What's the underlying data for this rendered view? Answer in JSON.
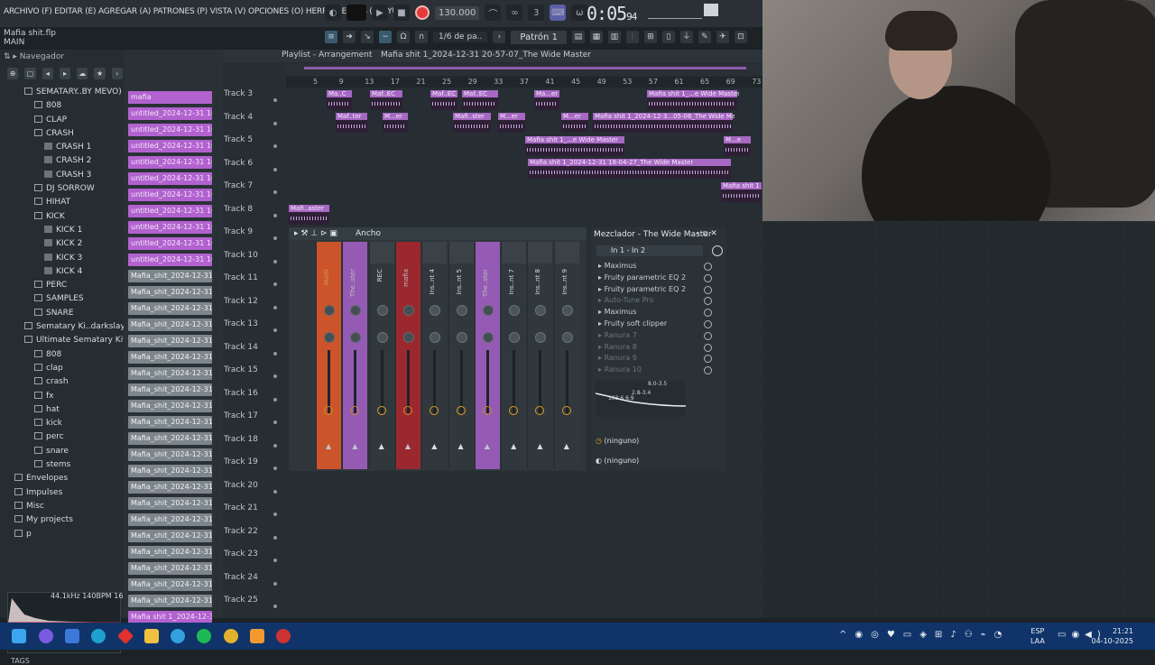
{
  "menu": {
    "text": "ARCHIVO (F) EDITAR (E) AGREGAR (A) PATRONES (P) VISTA (V) OPCIONES (O) HERRAMIENTAS (T) AYUDA"
  },
  "transport": {
    "tempo": "130.000",
    "time_main": "0:05",
    "time_sub": "94"
  },
  "project": {
    "name": "Mafia shit.flp",
    "sub": "MAIN"
  },
  "toolbar2": {
    "snap": "1/6 de pa..",
    "pattern": "Patrón 1"
  },
  "browser": {
    "header": "Navegador",
    "items": [
      {
        "label": "SEMATARY..BY MEVO)",
        "indent": 1,
        "type": "folder"
      },
      {
        "label": "808",
        "indent": 2,
        "type": "folder"
      },
      {
        "label": "CLAP",
        "indent": 2,
        "type": "folder"
      },
      {
        "label": "CRASH",
        "indent": 2,
        "type": "folder"
      },
      {
        "label": "CRASH 1",
        "indent": 3,
        "type": "file"
      },
      {
        "label": "CRASH 2",
        "indent": 3,
        "type": "file"
      },
      {
        "label": "CRASH 3",
        "indent": 3,
        "type": "file"
      },
      {
        "label": "DJ SORROW",
        "indent": 2,
        "type": "folder"
      },
      {
        "label": "HIHAT",
        "indent": 2,
        "type": "folder"
      },
      {
        "label": "KICK",
        "indent": 2,
        "type": "folder"
      },
      {
        "label": "KICK 1",
        "indent": 3,
        "type": "file"
      },
      {
        "label": "KICK 2",
        "indent": 3,
        "type": "file"
      },
      {
        "label": "KICK 3",
        "indent": 3,
        "type": "file"
      },
      {
        "label": "KICK 4",
        "indent": 3,
        "type": "file"
      },
      {
        "label": "PERC",
        "indent": 2,
        "type": "folder"
      },
      {
        "label": "SAMPLES",
        "indent": 2,
        "type": "folder"
      },
      {
        "label": "SNARE",
        "indent": 2,
        "type": "folder"
      },
      {
        "label": "Sematary Ki..darkslayrr]",
        "indent": 1,
        "type": "folder"
      },
      {
        "label": "Ultimate Sematary Kit",
        "indent": 1,
        "type": "folder"
      },
      {
        "label": "808",
        "indent": 2,
        "type": "folder"
      },
      {
        "label": "clap",
        "indent": 2,
        "type": "folder"
      },
      {
        "label": "crash",
        "indent": 2,
        "type": "folder"
      },
      {
        "label": "fx",
        "indent": 2,
        "type": "folder"
      },
      {
        "label": "hat",
        "indent": 2,
        "type": "folder"
      },
      {
        "label": "kick",
        "indent": 2,
        "type": "folder"
      },
      {
        "label": "perc",
        "indent": 2,
        "type": "folder"
      },
      {
        "label": "snare",
        "indent": 2,
        "type": "folder"
      },
      {
        "label": "stems",
        "indent": 2,
        "type": "folder"
      },
      {
        "label": "Envelopes",
        "indent": 0,
        "type": "folder"
      },
      {
        "label": "Impulses",
        "indent": 0,
        "type": "folder"
      },
      {
        "label": "Misc",
        "indent": 0,
        "type": "folder"
      },
      {
        "label": "My projects",
        "indent": 0,
        "type": "folder"
      },
      {
        "label": "p",
        "indent": 0,
        "type": "folder"
      }
    ],
    "wave_meta": "44.1kHz 140BPM 16",
    "tags": "TAGS"
  },
  "channels": {
    "mafia": "mafia",
    "untitled": "untitled_2024-12-31 16-...",
    "mafia_shit": "Mafia_shit_2024-12-31 1...",
    "last": "Mafia shit 1_2024-12-31..."
  },
  "playlist": {
    "title": "Playlist - Arrangement",
    "breadcrumb": "Mafia shit 1_2024-12-31 20-57-07_The Wide Master",
    "ruler": [
      "5",
      "9",
      "13",
      "17",
      "21",
      "25",
      "29",
      "33",
      "37",
      "41",
      "45",
      "49",
      "53",
      "57",
      "61",
      "65",
      "69",
      "73"
    ],
    "tracks": [
      "Track 3",
      "Track 4",
      "Track 5",
      "Track 6",
      "Track 7",
      "Track 8",
      "Track 9",
      "Track 10",
      "Track 11",
      "Track 12",
      "Track 13",
      "Track 14",
      "Track 15",
      "Track 16",
      "Track 17",
      "Track 18",
      "Track 19",
      "Track 20",
      "Track 21",
      "Track 22",
      "Track 23",
      "Track 24",
      "Track 25"
    ],
    "clips": {
      "ma_c": "Ma..C",
      "maf_ec": "Maf..EC",
      "ma_er": "Ma...er",
      "maf_ter": "Maf..ter",
      "m_er": "M...er",
      "mafi_ster": "Mafi..ster",
      "wide_master": "Mafia shit 1_...e Wide Master",
      "long1": "Mafia shit 1_2024-12-3...05-06_The Wide Master",
      "long2": "Mafia shit 1_2024-12-31 18-04-27_The Wide Master",
      "short_e": "Mafia shit 1_...e Wide Master",
      "m_e": "M...e",
      "mafia_shit1": "Mafia shit 1",
      "mafi_aster": "Mafi..aster"
    }
  },
  "mixer": {
    "toolbar_label": "Ancho",
    "strips": [
      {
        "label": "MAIN",
        "color": "#e85a28"
      },
      {
        "label": "The..ster",
        "color": "#a861c9"
      },
      {
        "label": "REC",
        "color": "#3a4247"
      },
      {
        "label": "mafia",
        "color": "#b0262e"
      },
      {
        "label": "Ins..nt 4",
        "color": "#3a4247"
      },
      {
        "label": "Ins..nt 5",
        "color": "#3a4247"
      },
      {
        "label": "The..ster",
        "color": "#a861c9"
      },
      {
        "label": "Ins..nt 7",
        "color": "#3a4247"
      },
      {
        "label": "Ins..nt 8",
        "color": "#3a4247"
      },
      {
        "label": "Ins..nt 9",
        "color": "#3a4247"
      }
    ]
  },
  "mixer_panel": {
    "title": "Mezclador - The Wide Master",
    "input": "In 1 - In 2",
    "slots": [
      {
        "label": "Maximus",
        "active": true
      },
      {
        "label": "Fruity parametric EQ 2",
        "active": true
      },
      {
        "label": "Fruity parametric EQ 2",
        "active": true
      },
      {
        "label": "Auto-Tune Pro",
        "active": false
      },
      {
        "label": "Maximus",
        "active": true
      },
      {
        "label": "Fruity soft clipper",
        "active": true
      },
      {
        "label": "Ranura 7",
        "active": false
      },
      {
        "label": "Ranura 8",
        "active": false
      },
      {
        "label": "Ranura 9",
        "active": false
      },
      {
        "label": "Ranura 10",
        "active": false
      }
    ],
    "eq_labels": [
      "8.0-3.5",
      "2.8-3.4",
      "103.6 6.9"
    ],
    "route1": "(ninguno)",
    "route2": "(ninguno)"
  },
  "taskbar": {
    "lang1": "ESP",
    "lang2": "LAA",
    "time": "21:21",
    "date": "04-10-2025"
  }
}
